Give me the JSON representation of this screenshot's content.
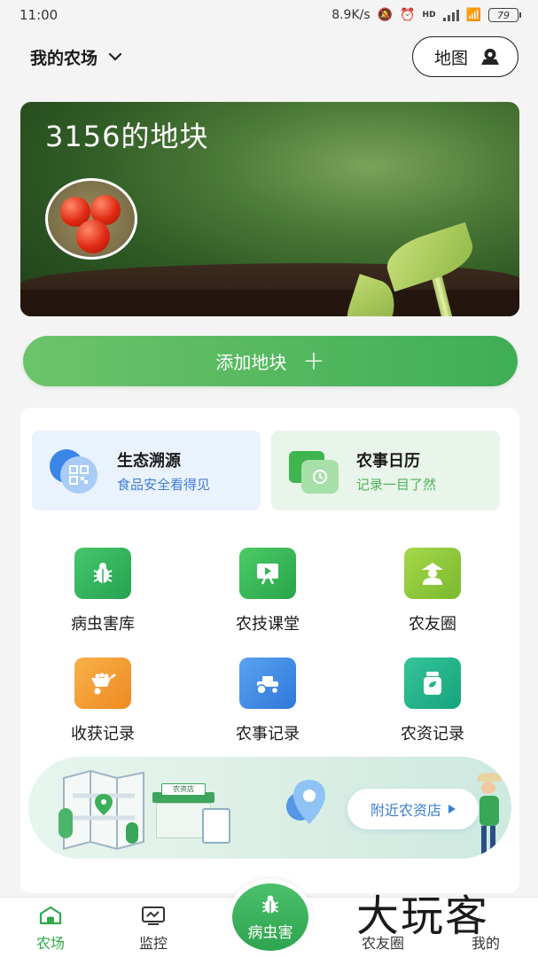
{
  "status_bar": {
    "time": "11:00",
    "net_speed": "8.9K/s",
    "hd": "HD",
    "battery": "79"
  },
  "header": {
    "farm_label": "我的农场",
    "map_label": "地图"
  },
  "hero": {
    "title": "3156的地块"
  },
  "add_plot": {
    "label": "添加地块",
    "plus": "+"
  },
  "features": [
    {
      "title": "生态溯源",
      "subtitle": "食品安全看得见"
    },
    {
      "title": "农事日历",
      "subtitle": "记录一目了然"
    }
  ],
  "grid": [
    {
      "label": "病虫害库",
      "icon": "bug-icon",
      "color": "#2fb15a"
    },
    {
      "label": "农技课堂",
      "icon": "video-board-icon",
      "color": "#34b556"
    },
    {
      "label": "农友圈",
      "icon": "farmer-icon",
      "color": "#8cc63f"
    },
    {
      "label": "收获记录",
      "icon": "wheelbarrow-icon",
      "color": "#f39a2c"
    },
    {
      "label": "农事记录",
      "icon": "tractor-icon",
      "color": "#3a86e0"
    },
    {
      "label": "农资记录",
      "icon": "jar-icon",
      "color": "#23b18a"
    }
  ],
  "banner": {
    "shop_sign": "农资店",
    "button_label": "附近农资店"
  },
  "bottom_nav": {
    "farm": "农场",
    "monitor": "监控",
    "pest": "病虫害",
    "friends": "农友圈",
    "mine": "我的"
  },
  "watermark": "大玩客",
  "colors": {
    "accent_green": "#2ea94a",
    "accent_blue": "#3a7fd0"
  }
}
